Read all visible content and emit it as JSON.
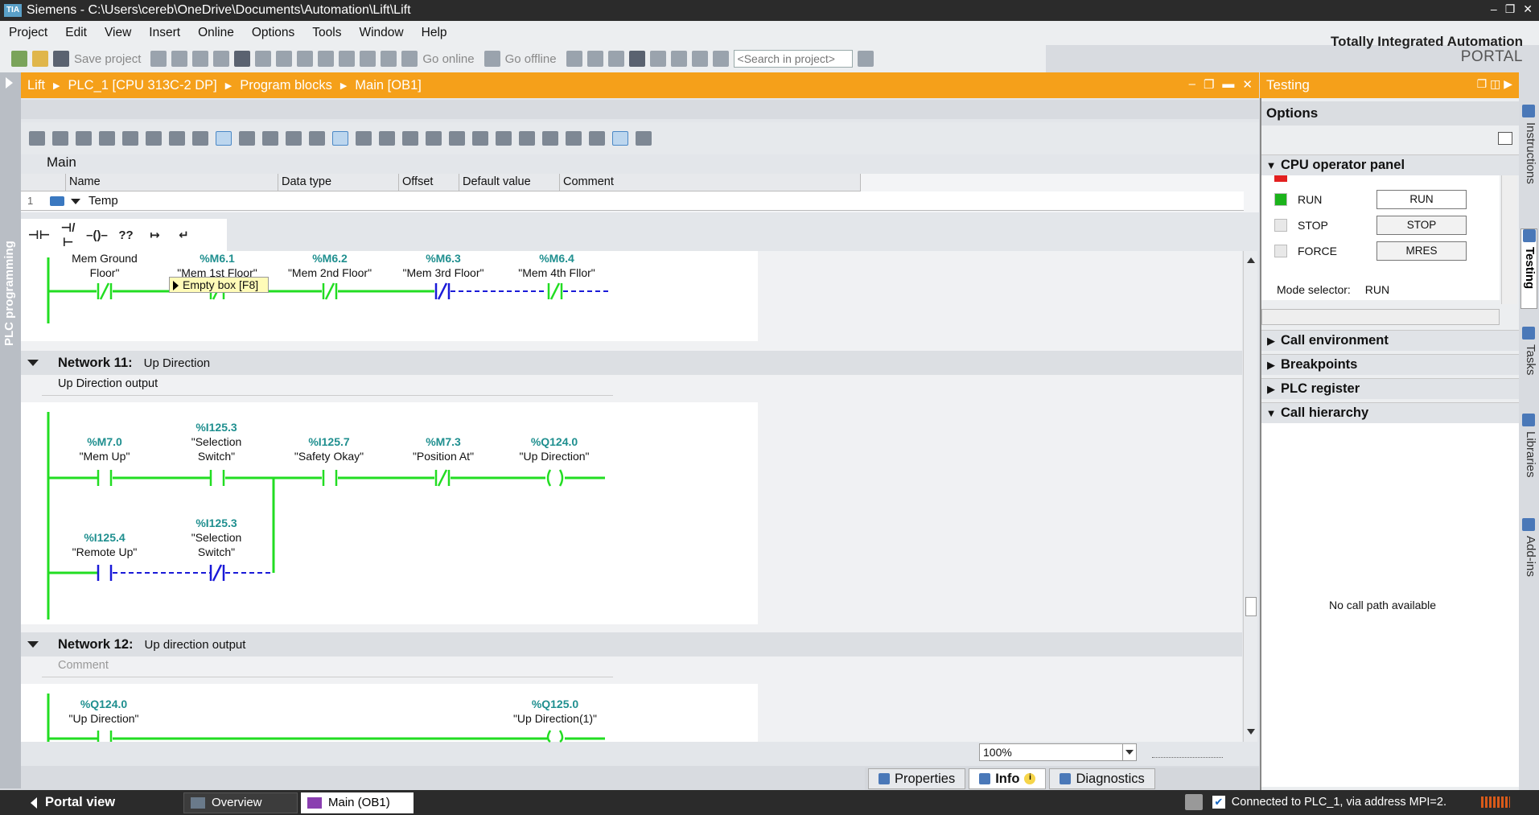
{
  "window": {
    "title": "Siemens - C:\\Users\\cereb\\OneDrive\\Documents\\Automation\\Lift\\Lift",
    "logo": "TIA"
  },
  "menu": [
    "Project",
    "Edit",
    "View",
    "Insert",
    "Online",
    "Options",
    "Tools",
    "Window",
    "Help"
  ],
  "toolbar": {
    "save_label": "Save project",
    "go_online": "Go online",
    "go_offline": "Go offline",
    "search_placeholder": "<Search in project>"
  },
  "branding": {
    "line1": "Totally Integrated Automation",
    "line2": "PORTAL"
  },
  "left_strip_label": "PLC programming",
  "breadcrumb": [
    "Lift",
    "PLC_1 [CPU 313C-2 DP]",
    "Program blocks",
    "Main [OB1]"
  ],
  "block": {
    "name": "Main"
  },
  "interface": {
    "columns": [
      "Name",
      "Data type",
      "Offset",
      "Default value",
      "Comment"
    ],
    "rows": [
      {
        "num": "1",
        "name": "Temp"
      }
    ]
  },
  "lad_toolbar": [
    "⊣⊢",
    "⊣/⊢",
    "–()–",
    "??",
    "↦",
    "↵"
  ],
  "tooltip": "Empty box [F8]",
  "network10_partial": {
    "contacts": [
      {
        "addr": "",
        "name": "Mem Ground",
        "name2": "Floor\""
      },
      {
        "addr": "%M6.1",
        "name": "\"Mem 1st Floor\""
      },
      {
        "addr": "%M6.2",
        "name": "\"Mem 2nd Floor\""
      },
      {
        "addr": "%M6.3",
        "name": "\"Mem 3rd Floor\""
      },
      {
        "addr": "%M6.4",
        "name": "\"Mem 4th Fllor\""
      }
    ]
  },
  "networks": [
    {
      "label": "Network 11:",
      "title": "Up Direction",
      "comment": "Up Direction output",
      "rung1": [
        {
          "addr": "%M7.0",
          "name": "\"Mem Up\""
        },
        {
          "addr": "%I125.3",
          "name": "\"Selection",
          "name2": "Switch\""
        },
        {
          "addr": "%I125.7",
          "name": "\"Safety Okay\""
        },
        {
          "addr": "%M7.3",
          "name": "\"Position At\""
        },
        {
          "addr": "%Q124.0",
          "name": "\"Up Direction\""
        }
      ],
      "rung2": [
        {
          "addr": "%I125.4",
          "name": "\"Remote Up\""
        },
        {
          "addr": "%I125.3",
          "name": "\"Selection",
          "name2": "Switch\""
        }
      ]
    },
    {
      "label": "Network 12:",
      "title": "Up direction output",
      "comment": "Comment",
      "rung1": [
        {
          "addr": "%Q124.0",
          "name": "\"Up Direction\""
        },
        {
          "addr": "%Q125.0",
          "name": "\"Up Direction(1)\""
        }
      ]
    }
  ],
  "zoom": "100%",
  "bottom_tabs": {
    "properties": "Properties",
    "info": "Info",
    "diagnostics": "Diagnostics"
  },
  "statusbar": {
    "portal_view": "Portal view",
    "overview": "Overview",
    "main": "Main (OB1)",
    "connection": "Connected to PLC_1, via address MPI=2."
  },
  "right_panel": {
    "title": "Testing",
    "options": "Options",
    "sections": {
      "cpu": "CPU operator panel",
      "call_env": "Call environment",
      "breakpoints": "Breakpoints",
      "plc_register": "PLC register",
      "call_hierarchy": "Call hierarchy"
    },
    "cpu_panel": {
      "leds": [
        {
          "label": "RUN",
          "color": "#1bb31b",
          "button": "RUN"
        },
        {
          "label": "STOP",
          "color": "#e8e8e8",
          "button": "STOP"
        },
        {
          "label": "FORCE",
          "color": "#e8e8e8",
          "button": "MRES"
        }
      ],
      "error_led_color": "#e32020",
      "mode_selector_label": "Mode selector:",
      "mode_selector_value": "RUN"
    },
    "no_call_path": "No call path available"
  },
  "side_tabs": [
    "Instructions",
    "Testing",
    "Tasks",
    "Libraries",
    "Add-ins"
  ],
  "colors": {
    "accent": "#f5a01a",
    "rung": "#22dd22",
    "unpowered": "#1a1ad8",
    "address": "#1f8f8f"
  }
}
